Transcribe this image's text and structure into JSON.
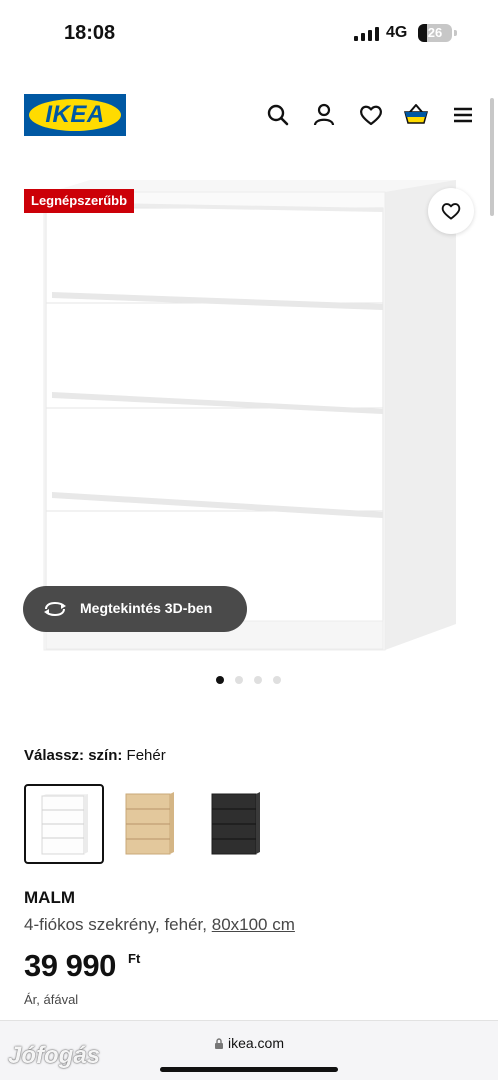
{
  "status_bar": {
    "time": "18:08",
    "network": "4G",
    "battery": "26"
  },
  "header": {
    "logo_text": "IKEA",
    "icons": [
      "search-icon",
      "user-icon",
      "heart-icon",
      "basket-icon",
      "menu-icon"
    ]
  },
  "hero": {
    "badge": "Legnépszerűbb",
    "view3d_label": "Megtekintés 3D-ben",
    "image_count": 4,
    "active_image": 1
  },
  "color_selector": {
    "label": "Válassz: szín:",
    "selected_value": "Fehér",
    "options": [
      "white",
      "oak-veneer",
      "black-brown"
    ]
  },
  "product": {
    "name": "MALM",
    "description": "4-fiókos szekrény, fehér,",
    "size": "80x100 cm",
    "price": "39 990",
    "currency": "Ft",
    "price_note": "Ár, áfával"
  },
  "browser": {
    "url": "ikea.com"
  },
  "watermark": "Jófogás",
  "colors": {
    "brand_blue": "#0058a3",
    "brand_yellow": "#ffdb00",
    "badge_red": "#cc0008"
  }
}
